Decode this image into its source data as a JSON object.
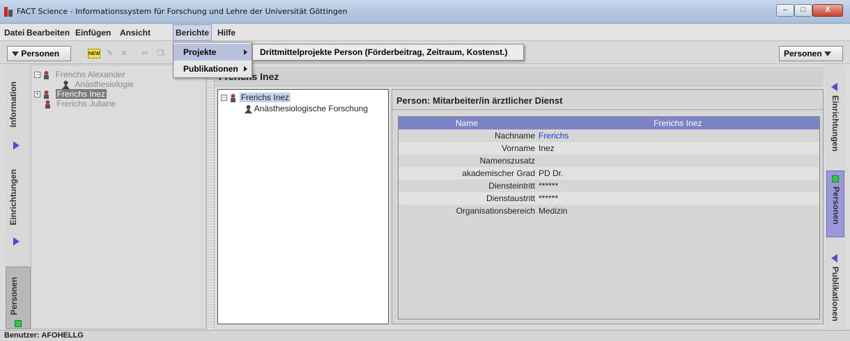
{
  "window": {
    "title": "FACT Science - Informationssystem für Forschung und Lehre der Universität Göttingen",
    "controls": {
      "minimize": "–",
      "maximize": "□",
      "close": "X"
    }
  },
  "menubar": {
    "datei": "Datei",
    "bearbeiten": "Bearbeiten",
    "einfuegen": "Einfügen",
    "ansicht": "Ansicht",
    "berichte": "Berichte",
    "hilfe": "Hilfe"
  },
  "toolbar": {
    "left_dropdown": "Personen",
    "right_dropdown": "Personen",
    "new_icon_label": "NEW"
  },
  "berichte_menu": {
    "projekte": "Projekte",
    "publikationen": "Publikationen",
    "projekte_submenu_item": "Drittmittelprojekte Person (Förderbeitrag, Zeitraum, Kostenst.)"
  },
  "left_tabs": {
    "information": "Information",
    "einrichtungen": "Einrichtungen",
    "personen": "Personen"
  },
  "left_tree": {
    "items": [
      {
        "label": "Frerichs Alexander"
      },
      {
        "label": "Anästhesiologie"
      },
      {
        "label": "Frerichs Inez"
      },
      {
        "label": "Frerichs Juliane"
      }
    ]
  },
  "main": {
    "header_title": "Frerichs Inez",
    "tree": {
      "root": "Frerichs Inez",
      "child": "Anästhesiologische Forschung"
    },
    "detail_title": "Person: Mitarbeiter/in ärztlicher Dienst",
    "table": {
      "col_name": "Name",
      "col_value": "Frerichs Inez",
      "rows": [
        {
          "label": "Nachname",
          "value": "Frerichs"
        },
        {
          "label": "Vorname",
          "value": "Inez"
        },
        {
          "label": "Namenszusatz",
          "value": ""
        },
        {
          "label": "akademischer Grad",
          "value": "PD Dr."
        },
        {
          "label": "Diensteintritt",
          "value": "******"
        },
        {
          "label": "Dienstaustritt",
          "value": "******"
        },
        {
          "label": "Organisationsbereich",
          "value": "Medizin"
        }
      ]
    }
  },
  "right_tabs": {
    "einrichtungen": "Einrichtungen",
    "personen": "Personen",
    "publikationen": "Publikationen"
  },
  "statusbar": {
    "user": "Benutzer: AFOHELLG"
  },
  "colors": {
    "accent_tab": "#9a98d8",
    "table_header": "#7a83c5",
    "link": "#1a3adc",
    "arrow": "#5b47c9",
    "active_indicator": "#2ecc40"
  }
}
